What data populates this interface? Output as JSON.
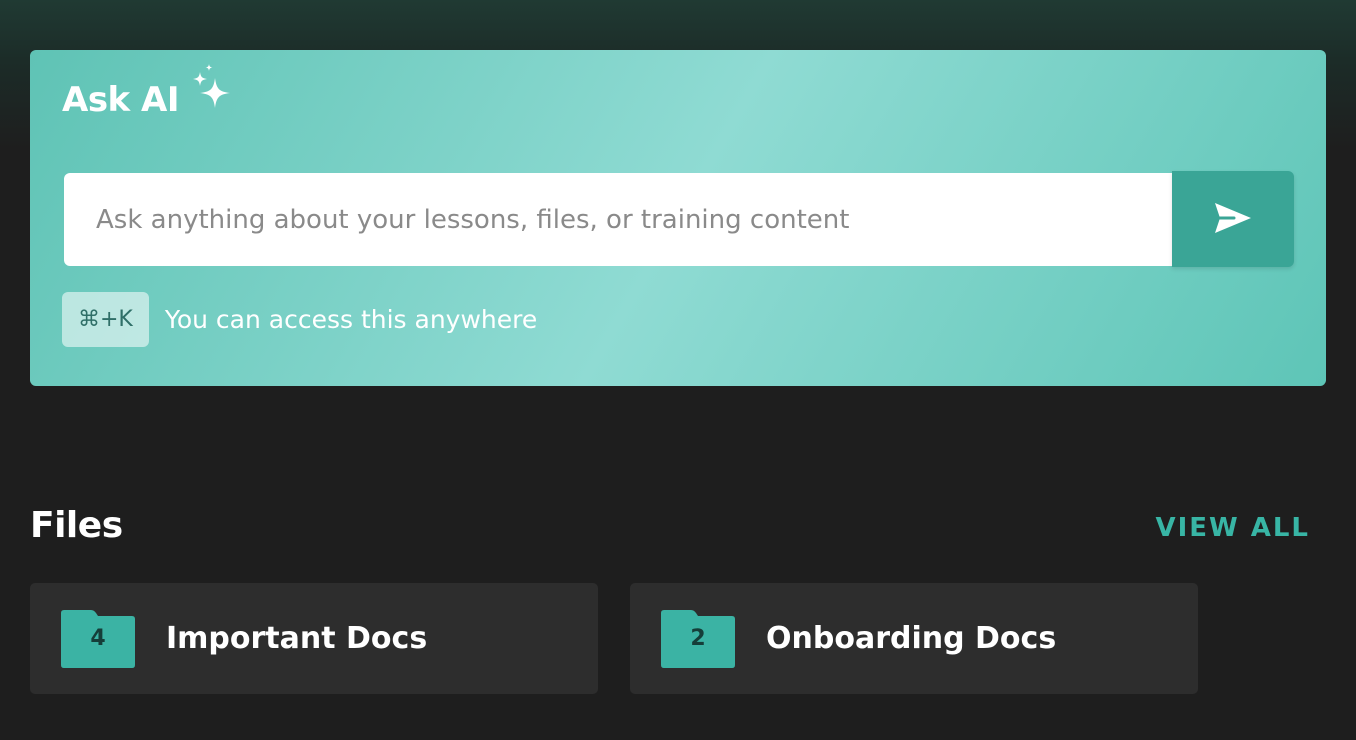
{
  "ask_ai": {
    "title": "Ask AI",
    "input_placeholder": "Ask anything about your lessons, files, or training content",
    "shortcut_key": "⌘+K",
    "shortcut_hint": "You can access this anywhere"
  },
  "files_section": {
    "title": "Files",
    "view_all_label": "VIEW ALL",
    "folders": [
      {
        "name": "Important Docs",
        "count": "4"
      },
      {
        "name": "Onboarding Docs",
        "count": "2"
      }
    ]
  },
  "colors": {
    "accent": "#3aa596",
    "accent_light": "#8fdbd3",
    "background": "#1e1e1e",
    "card": "#2d2d2d",
    "folder": "#3bb3a4"
  },
  "icons": {
    "title_icon": "sparkles-icon",
    "send_icon": "send-icon",
    "folder_icon": "folder-icon"
  }
}
